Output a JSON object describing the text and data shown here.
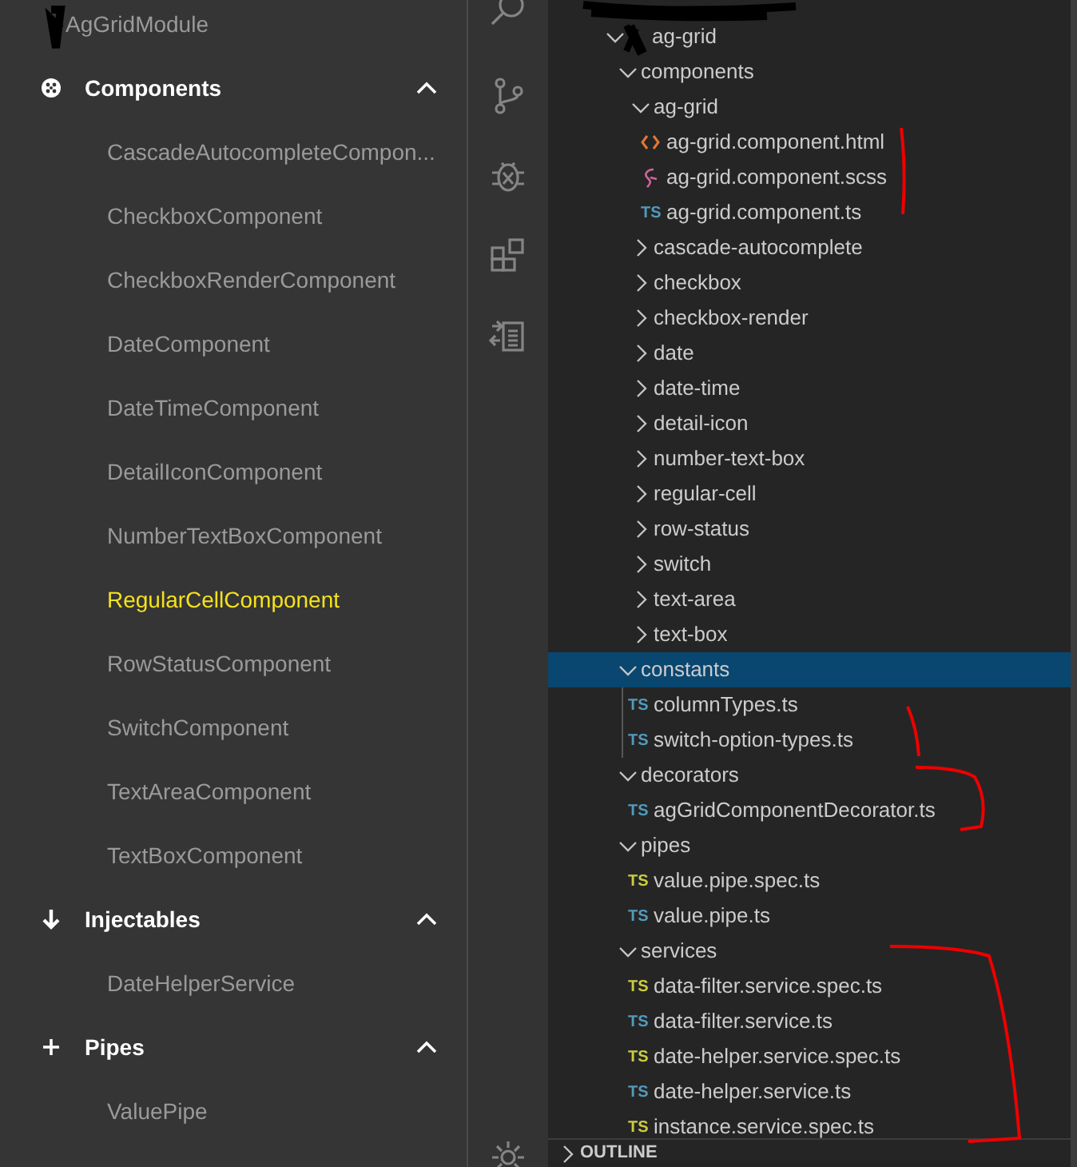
{
  "left_nav": {
    "module": "AgGridModule",
    "sections": [
      {
        "kind": "components",
        "label": "Components",
        "expanded": true,
        "items": [
          {
            "label": "CascadeAutocompleteCompon...",
            "selected": false
          },
          {
            "label": "CheckboxComponent",
            "selected": false
          },
          {
            "label": "CheckboxRenderComponent",
            "selected": false
          },
          {
            "label": "DateComponent",
            "selected": false
          },
          {
            "label": "DateTimeComponent",
            "selected": false
          },
          {
            "label": "DetailIconComponent",
            "selected": false
          },
          {
            "label": "NumberTextBoxComponent",
            "selected": false
          },
          {
            "label": "RegularCellComponent",
            "selected": true
          },
          {
            "label": "RowStatusComponent",
            "selected": false
          },
          {
            "label": "SwitchComponent",
            "selected": false
          },
          {
            "label": "TextAreaComponent",
            "selected": false
          },
          {
            "label": "TextBoxComponent",
            "selected": false
          }
        ]
      },
      {
        "kind": "injectables",
        "label": "Injectables",
        "expanded": true,
        "items": [
          {
            "label": "DateHelperService",
            "selected": false
          }
        ]
      },
      {
        "kind": "pipes",
        "label": "Pipes",
        "expanded": true,
        "items": [
          {
            "label": "ValuePipe",
            "selected": false
          }
        ]
      }
    ]
  },
  "explorer": {
    "tree": [
      {
        "kind": "folder",
        "label": "ag-grid",
        "expanded": true,
        "selected": false,
        "children": [
          {
            "kind": "folder",
            "label": "components",
            "expanded": true,
            "selected": false,
            "children": [
              {
                "kind": "folder",
                "label": "ag-grid",
                "expanded": true,
                "selected": false,
                "children": [
                  {
                    "kind": "html",
                    "label": "ag-grid.component.html",
                    "selected": false
                  },
                  {
                    "kind": "scss",
                    "label": "ag-grid.component.scss",
                    "selected": false
                  },
                  {
                    "kind": "ts",
                    "badge": "TS",
                    "label": "ag-grid.component.ts",
                    "selected": false
                  }
                ]
              },
              {
                "kind": "folder",
                "label": "cascade-autocomplete",
                "expanded": false,
                "selected": false
              },
              {
                "kind": "folder",
                "label": "checkbox",
                "expanded": false,
                "selected": false
              },
              {
                "kind": "folder",
                "label": "checkbox-render",
                "expanded": false,
                "selected": false
              },
              {
                "kind": "folder",
                "label": "date",
                "expanded": false,
                "selected": false
              },
              {
                "kind": "folder",
                "label": "date-time",
                "expanded": false,
                "selected": false
              },
              {
                "kind": "folder",
                "label": "detail-icon",
                "expanded": false,
                "selected": false
              },
              {
                "kind": "folder",
                "label": "number-text-box",
                "expanded": false,
                "selected": false
              },
              {
                "kind": "folder",
                "label": "regular-cell",
                "expanded": false,
                "selected": false
              },
              {
                "kind": "folder",
                "label": "row-status",
                "expanded": false,
                "selected": false
              },
              {
                "kind": "folder",
                "label": "switch",
                "expanded": false,
                "selected": false
              },
              {
                "kind": "folder",
                "label": "text-area",
                "expanded": false,
                "selected": false
              },
              {
                "kind": "folder",
                "label": "text-box",
                "expanded": false,
                "selected": false
              }
            ]
          },
          {
            "kind": "folder",
            "label": "constants",
            "expanded": true,
            "selected": true,
            "children": [
              {
                "kind": "ts",
                "badge": "TS",
                "label": "columnTypes.ts",
                "selected": false
              },
              {
                "kind": "ts",
                "badge": "TS",
                "label": "switch-option-types.ts",
                "selected": false
              }
            ]
          },
          {
            "kind": "folder",
            "label": "decorators",
            "expanded": true,
            "selected": false,
            "children": [
              {
                "kind": "ts",
                "badge": "TS",
                "label": "agGridComponentDecorator.ts",
                "selected": false
              }
            ]
          },
          {
            "kind": "folder",
            "label": "pipes",
            "expanded": true,
            "selected": false,
            "children": [
              {
                "kind": "spec",
                "badge": "TS",
                "label": "value.pipe.spec.ts",
                "selected": false
              },
              {
                "kind": "ts",
                "badge": "TS",
                "label": "value.pipe.ts",
                "selected": false
              }
            ]
          },
          {
            "kind": "folder",
            "label": "services",
            "expanded": true,
            "selected": false,
            "children": [
              {
                "kind": "spec",
                "badge": "TS",
                "label": "data-filter.service.spec.ts",
                "selected": false
              },
              {
                "kind": "ts",
                "badge": "TS",
                "label": "data-filter.service.ts",
                "selected": false
              },
              {
                "kind": "spec",
                "badge": "TS",
                "label": "date-helper.service.spec.ts",
                "selected": false
              },
              {
                "kind": "ts",
                "badge": "TS",
                "label": "date-helper.service.ts",
                "selected": false
              },
              {
                "kind": "spec",
                "badge": "TS",
                "label": "instance.service.spec.ts",
                "selected": false
              }
            ]
          }
        ]
      }
    ],
    "outline": {
      "label": "OUTLINE",
      "expanded": false
    }
  }
}
